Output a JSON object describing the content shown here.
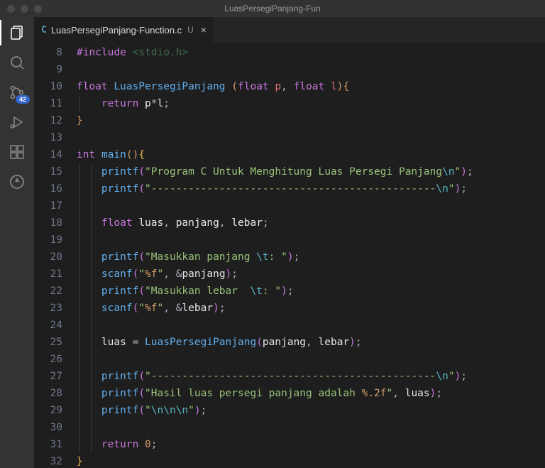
{
  "window": {
    "title": "LuasPersegiPanjang-Fun"
  },
  "activity": {
    "scm_badge": "42"
  },
  "tab": {
    "icon_letter": "C",
    "filename": "LuasPersegiPanjang-Function.c",
    "dirty_mark": "U",
    "close_glyph": "×"
  },
  "gutter": {
    "start": 8,
    "end": 32
  },
  "code": {
    "include_kw": "#include",
    "include_lib": " <stdio.h>",
    "float_kw": "float",
    "int_kw": "int",
    "return_kw": "return",
    "fn_luas": "LuasPersegiPanjang",
    "fn_main": "main",
    "fn_printf": "printf",
    "fn_scanf": "scanf",
    "param_p": "p",
    "param_l": "l",
    "var_luas": "luas",
    "var_panjang": "panjang",
    "var_lebar": "lebar",
    "zero": "0",
    "amp": "&",
    "star": "*",
    "eq": " = ",
    "comma_sp": ", ",
    "semi": ";",
    "open_p": "(",
    "close_p": ")",
    "open_b": "{",
    "close_b": "}",
    "sp": " ",
    "s_title": "\"Program C Untuk Menghitung Luas Persegi Panjang",
    "s_sep": "\"----------------------------------------------",
    "s_nl_end": "\\n",
    "s_q": "\"",
    "s_prompt_panjang": "\"Masukkan panjang ",
    "s_prompt_lebar": "\"Masukkan lebar  ",
    "s_tab_colon": "\\t",
    "s_tab_tail": ": \"",
    "s_fmt_f": "\"",
    "s_pct_f": "%f",
    "s_hasil": "\"Hasil luas persegi panjang adalah ",
    "s_pct_2f": "%.2f",
    "s_triple_nl": "\"",
    "s_triple_nl_body": "\\n\\n\\n"
  }
}
